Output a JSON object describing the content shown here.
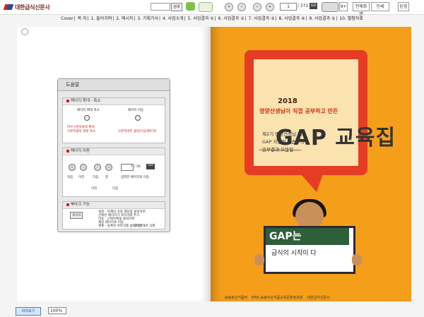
{
  "app": {
    "logo_text": "대한급식신문사"
  },
  "toolbar": {
    "search_placeholder": "",
    "search_label": "검색",
    "current_page": "1",
    "total_pages": "/ 371",
    "go_label": "GO",
    "fullscreen_label": "전체화면",
    "page_mode_label": "9+",
    "close_label": "닫힘",
    "print_label": "인쇄"
  },
  "toc": {
    "items": [
      "Cover",
      "목 차",
      "1. 들어가며",
      "2. 에시지",
      "3. 기획기사",
      "4. 사업소개",
      "5. 사업결과 ①",
      "6. 사업결과 ②",
      "7. 사업결과 ③",
      "8. 사업결과 ④",
      "9. 사업결과 ⑤",
      "10. 별첨자료"
    ]
  },
  "help": {
    "title": "도움말",
    "zoom": {
      "title": "페이지 확대 · 축소",
      "left_label": "페이지 확대 축소",
      "right_label": "페이지 이동",
      "left_note": "마우스왼쪽클릭 확대\n오른쪽클릭 원래 축소",
      "right_note": "오른쪽버튼 클릭(다음페이지)"
    },
    "move": {
      "title": "페이지 이동",
      "page_value": "1",
      "total": "/ 56",
      "go": "GO",
      "labels": [
        "처음",
        "이전",
        "다음",
        "끝",
        "입력한 페이지로 이동"
      ],
      "sub_labels": [
        "이전",
        "다음"
      ]
    },
    "bookmark": {
      "title": "북마크 기능",
      "button_label": "북마크",
      "lines": [
        "설정 - 현재의 각종 해당함 클릭하면",
        "선택된 페이지가 북마크에 추가",
        "이동 - 선택목록을 클릭하면",
        "해당 페이지로 이동",
        "해제 - 등록된 북마크를 클릭하면",
        "북마크에서 삭제"
      ]
    }
  },
  "cover": {
    "year": "2018",
    "subtitle": "영양선생님이 직접 공부하고 만든",
    "title": "GAP 교육집",
    "english": "<Good Agricultural Practices>",
    "desc_lines": [
      "제2기 영양선생님 대상",
      "GAP 자발적 학습조직",
      "공부결과 모음집"
    ],
    "sign_top": "GAP는",
    "sign_bottom": "급식의 시작이 다",
    "footer_orgs": [
      "농림축산식품부",
      "EPIS 농림수산식품교육문화정보원",
      "대한급식신문사"
    ]
  },
  "bottom": {
    "thumbnail_label": "미리보기",
    "zoom_value": "100%"
  },
  "colors": {
    "cover_bg": "#f59e1a",
    "bubble": "#e53d23",
    "accent": "#c8232c"
  }
}
